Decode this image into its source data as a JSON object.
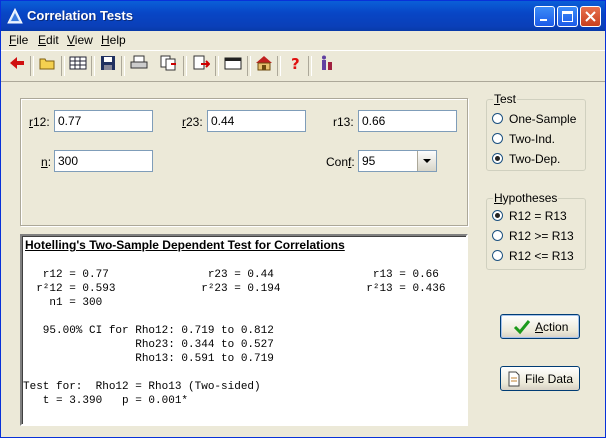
{
  "window": {
    "title": "Correlation Tests"
  },
  "menu": [
    {
      "label": "File",
      "accel": "F",
      "rest": "ile"
    },
    {
      "label": "Edit",
      "accel": "E",
      "rest": "dit"
    },
    {
      "label": "View",
      "accel": "V",
      "rest": "iew"
    },
    {
      "label": "Help",
      "accel": "H",
      "rest": "elp"
    }
  ],
  "inputs": {
    "r12": {
      "label_accel": "r",
      "label_rest": "12:",
      "value": "0.77"
    },
    "r23": {
      "label_accel": "r",
      "label_rest": "23:",
      "value": "0.44"
    },
    "r13": {
      "label": "r13:",
      "value": "0.66"
    },
    "n": {
      "label_accel": "n",
      "label_rest": ":",
      "value": "300"
    },
    "conf": {
      "label_pre": "Con",
      "label_accel": "f",
      "label_rest": ":",
      "value": "95"
    }
  },
  "test_group": {
    "title_accel": "T",
    "title_rest": "est",
    "options": [
      "One-Sample",
      "Two-Ind.",
      "Two-Dep."
    ],
    "selected": "Two-Dep."
  },
  "hyp_group": {
    "title_accel": "H",
    "title_rest": "ypotheses",
    "options": [
      "R12 = R13",
      "R12 >= R13",
      "R12 <= R13"
    ],
    "selected": "R12 = R13"
  },
  "output": {
    "heading": "Hotelling's Two-Sample Dependent Test for Correlations",
    "lines": [
      "   r12 = 0.77               r23 = 0.44               r13 = 0.66",
      "  r²12 = 0.593             r²23 = 0.194             r²13 = 0.436",
      "    n1 = 300",
      "",
      "   95.00% CI for Rho12: 0.719 to 0.812",
      "                 Rho23: 0.344 to 0.527",
      "                 Rho13: 0.591 to 0.719",
      "",
      "Test for:  Rho12 = Rho13 (Two-sided)",
      "   t = 3.390   p = 0.001*"
    ]
  },
  "buttons": {
    "action": {
      "accel": "A",
      "rest": "ction"
    },
    "file_data": "File Data"
  },
  "colors": {
    "title_bar": "#0a4fcf",
    "accent_green": "#1c9a1c",
    "output_bg": "#ffffff"
  }
}
